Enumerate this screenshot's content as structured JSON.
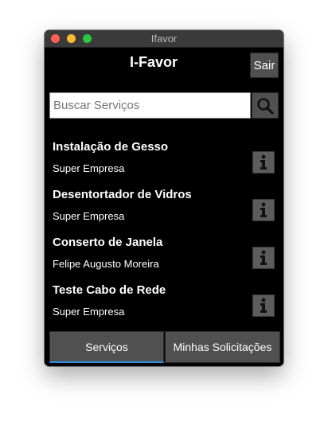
{
  "window": {
    "title": "Ifavor"
  },
  "header": {
    "title": "I-Favor",
    "logout_label": "Sair"
  },
  "search": {
    "placeholder": "Buscar Serviços",
    "value": ""
  },
  "services": [
    {
      "title": "Instalação de Gesso",
      "provider": "Super Empresa"
    },
    {
      "title": "Desentortador de Vidros",
      "provider": "Super Empresa"
    },
    {
      "title": "Conserto de Janela",
      "provider": "Felipe Augusto Moreira"
    },
    {
      "title": "Teste Cabo de Rede",
      "provider": "Super Empresa"
    }
  ],
  "tabs": [
    {
      "label": "Serviços",
      "active": true
    },
    {
      "label": "Minhas Solicitações",
      "active": false
    }
  ],
  "colors": {
    "accent": "#2c8de0",
    "background": "#000000",
    "button": "#505050"
  }
}
